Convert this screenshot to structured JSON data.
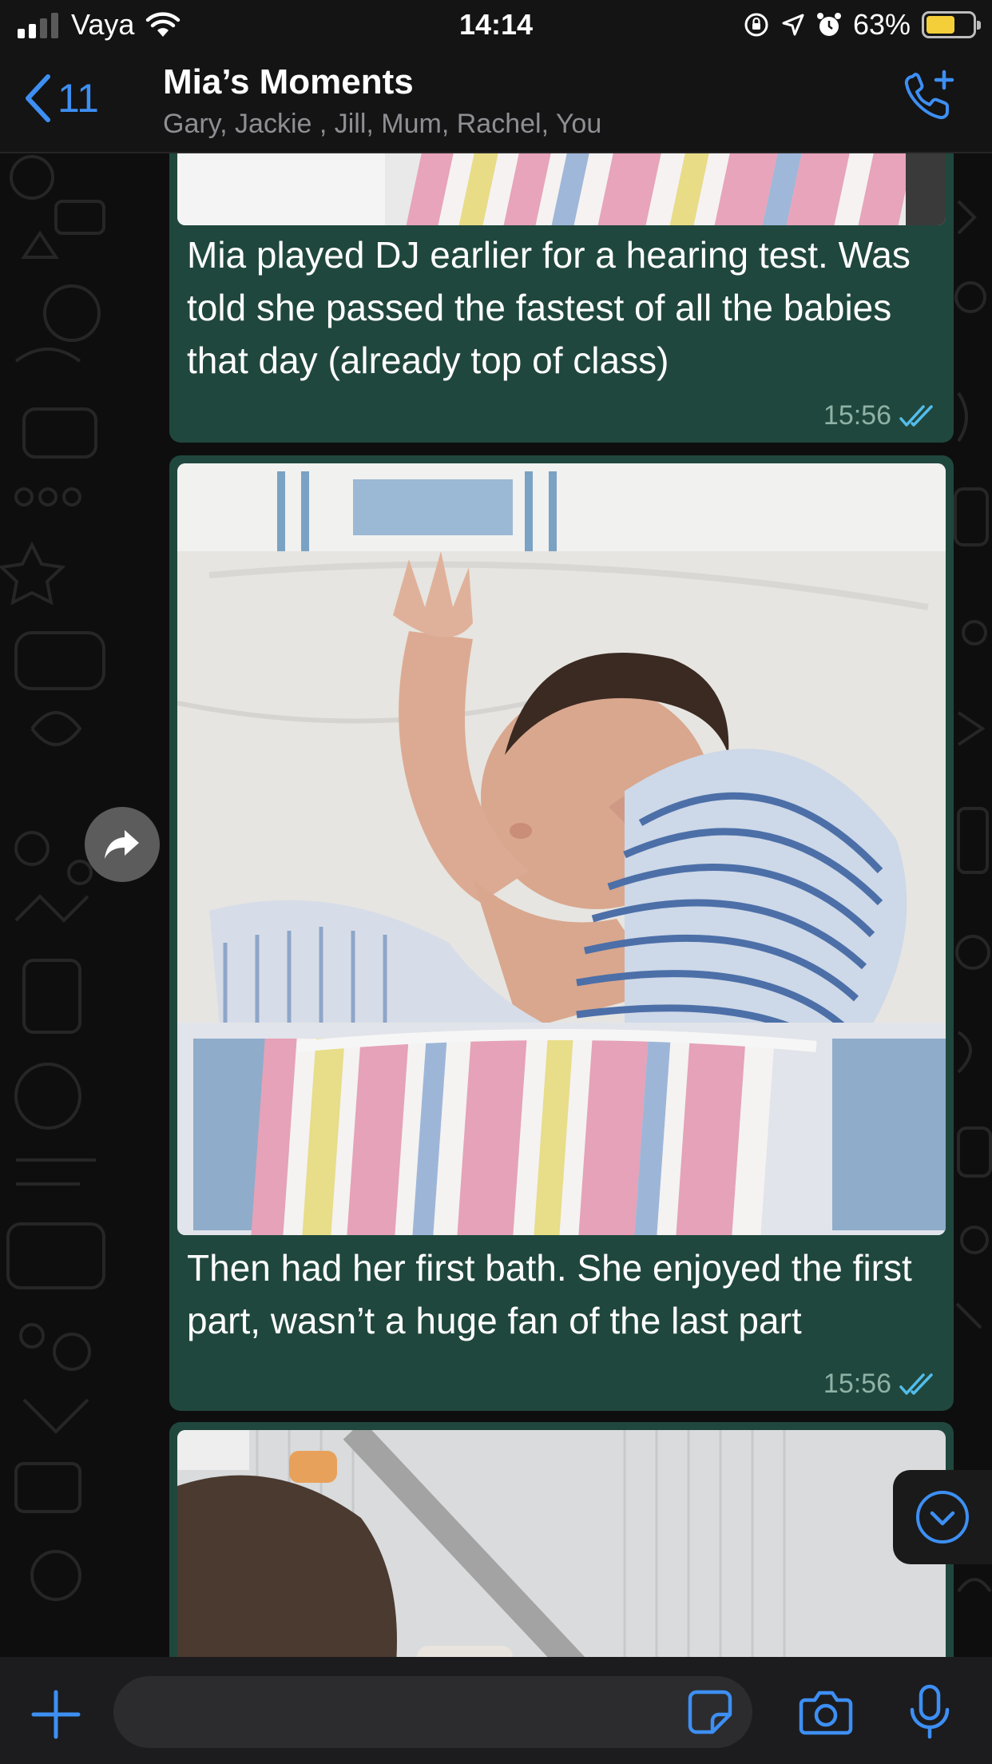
{
  "status_bar": {
    "carrier": "Vaya",
    "time": "14:14",
    "battery_percent": "63%",
    "battery_level": 0.63,
    "signal_bars_active": 2,
    "icons": [
      "wifi-icon",
      "orientation-lock-icon",
      "location-icon",
      "alarm-icon"
    ]
  },
  "header": {
    "back_count": "11",
    "title": "Mia’s Moments",
    "members": "Gary, Jackie , Jill, Mum, Rachel, You",
    "call_icon": "add-call-icon"
  },
  "messages": [
    {
      "type": "photo-caption",
      "text": "Mia played DJ earlier for a hearing test. Was told she passed the fastest of all the babies that day (already top of class)",
      "time": "15:56",
      "status": "read"
    },
    {
      "type": "photo-caption",
      "text": "Then had her first bath. She enjoyed the first part, wasn’t a huge fan of the last part",
      "time": "15:56",
      "status": "read"
    },
    {
      "type": "photo",
      "text": "",
      "time": "",
      "status": ""
    }
  ],
  "input_bar": {
    "placeholder": "",
    "icons": [
      "plus-icon",
      "sticker-icon",
      "camera-icon",
      "microphone-icon"
    ]
  },
  "colors": {
    "accent": "#3d8ff3",
    "bubble_outgoing": "#20473d",
    "read_ticks": "#53bdeb",
    "background": "#0e0e0e",
    "bar": "#1c1c1e"
  }
}
